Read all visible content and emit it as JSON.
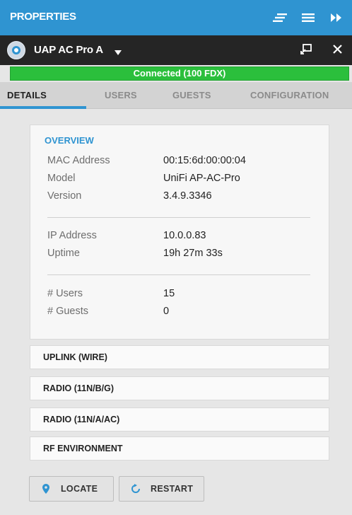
{
  "header": {
    "title": "PROPERTIES",
    "icons": [
      "collapse-lines-icon",
      "menu-icon",
      "fast-forward-icon"
    ]
  },
  "device": {
    "name": "UAP AC Pro A",
    "status_color": "#2f94d1",
    "actions": [
      "popout-icon",
      "close-icon"
    ]
  },
  "status": {
    "text": "Connected (100 FDX)",
    "color": "#2bbf3c"
  },
  "tabs": [
    {
      "label": "DETAILS",
      "active": true
    },
    {
      "label": "USERS",
      "active": false
    },
    {
      "label": "GUESTS",
      "active": false
    },
    {
      "label": "CONFIGURATION",
      "active": false
    }
  ],
  "overview": {
    "title": "OVERVIEW",
    "groups": [
      [
        {
          "label": "MAC Address",
          "value": "00:15:6d:00:00:04"
        },
        {
          "label": "Model",
          "value": "UniFi AP-AC-Pro"
        },
        {
          "label": "Version",
          "value": "3.4.9.3346"
        }
      ],
      [
        {
          "label": "IP Address",
          "value": "10.0.0.83"
        },
        {
          "label": "Uptime",
          "value": "19h 27m 33s"
        }
      ],
      [
        {
          "label": "# Users",
          "value": "15"
        },
        {
          "label": "# Guests",
          "value": "0"
        }
      ]
    ]
  },
  "sections": [
    {
      "label": "UPLINK (WIRE)"
    },
    {
      "label": "RADIO (11N/B/G)"
    },
    {
      "label": "RADIO (11N/A/AC)"
    },
    {
      "label": "RF ENVIRONMENT"
    }
  ],
  "buttons": {
    "locate": {
      "label": "LOCATE",
      "icon": "location-pin-icon"
    },
    "restart": {
      "label": "RESTART",
      "icon": "restart-icon"
    }
  },
  "colors": {
    "accent": "#2f94d1",
    "device_bar": "#252525",
    "connected": "#2bbf3c"
  }
}
